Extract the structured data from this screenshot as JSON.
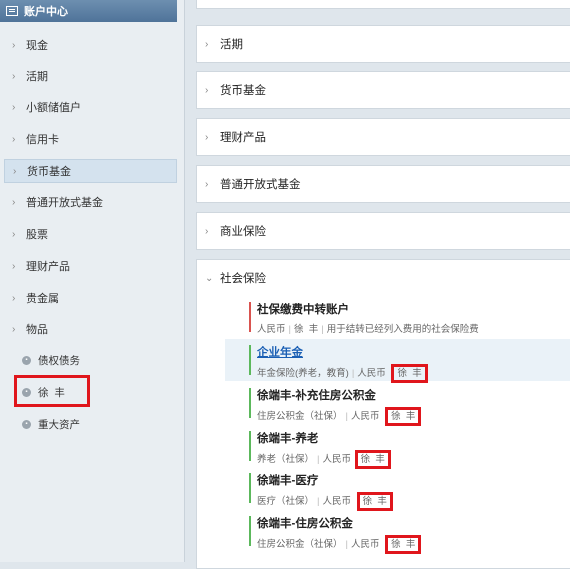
{
  "sidebar": {
    "title": "账户中心",
    "items": [
      {
        "label": "现金"
      },
      {
        "label": "活期"
      },
      {
        "label": "小额储值户"
      },
      {
        "label": "信用卡"
      },
      {
        "label": "货币基金"
      },
      {
        "label": "普通开放式基金"
      },
      {
        "label": "股票"
      },
      {
        "label": "理财产品"
      },
      {
        "label": "贵金属"
      },
      {
        "label": "物品"
      }
    ],
    "subitems": [
      {
        "label": "债权债务",
        "icon": "debt-icon"
      },
      {
        "label": "徐  丰",
        "icon": "item-icon"
      },
      {
        "label": "重大资产",
        "icon": "asset-icon"
      }
    ]
  },
  "main": {
    "panels": [
      {
        "label": "活期"
      },
      {
        "label": "货币基金"
      },
      {
        "label": "理财产品"
      },
      {
        "label": "普通开放式基金"
      },
      {
        "label": "商业保险"
      },
      {
        "label": "社会保险"
      }
    ],
    "accounts": [
      {
        "name": "社保缴费中转账户",
        "type": "人民币",
        "owner": "徐  丰",
        "note": "用于结转已经列入费用的社会保险费",
        "bar_color": "#d9534f"
      },
      {
        "name": "企业年金",
        "type": "年金保险(养老，教育)",
        "currency": "人民币",
        "owner": "徐  丰",
        "bar_color": "#5cb85c"
      },
      {
        "name": "徐端丰-补充住房公积金",
        "type": "住房公积金（社保）",
        "currency": "人民币",
        "owner": "徐  丰",
        "bar_color": "#5cb85c"
      },
      {
        "name": "徐端丰-养老",
        "type": "养老（社保）",
        "currency": "人民币",
        "owner": "徐  丰",
        "bar_color": "#5cb85c"
      },
      {
        "name": "徐端丰-医疗",
        "type": "医疗（社保）",
        "currency": "人民币",
        "owner": "徐  丰",
        "bar_color": "#5cb85c"
      },
      {
        "name": "徐端丰-住房公积金",
        "type": "住房公积金（社保）",
        "currency": "人民币",
        "owner": "徐  丰",
        "bar_color": "#5cb85c"
      }
    ]
  }
}
